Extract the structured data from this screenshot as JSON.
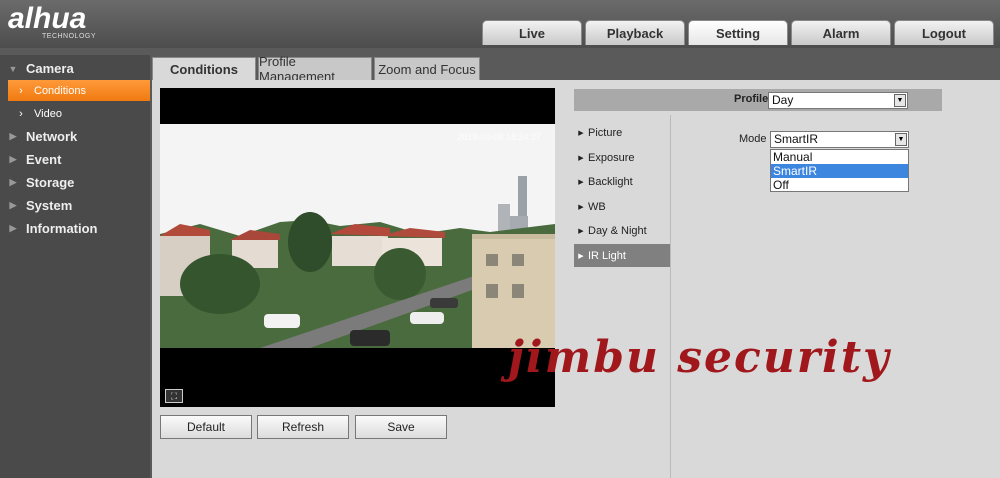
{
  "logo": {
    "text": "alhua",
    "subtitle": "TECHNOLOGY"
  },
  "nav": {
    "tabs": [
      "Live",
      "Playback",
      "Setting",
      "Alarm",
      "Logout"
    ],
    "active": "Setting"
  },
  "sidebar": {
    "items": [
      {
        "label": "Camera",
        "expanded": true
      },
      {
        "label": "Conditions",
        "sub": true,
        "active": true
      },
      {
        "label": "Video",
        "sub": true
      },
      {
        "label": "Network"
      },
      {
        "label": "Event"
      },
      {
        "label": "Storage"
      },
      {
        "label": "System"
      },
      {
        "label": "Information"
      }
    ]
  },
  "content_tabs": [
    "Conditions",
    "Profile Management",
    "Zoom and Focus"
  ],
  "video": {
    "timestamp": "2018-09-08 18:34:27",
    "fullscreen_icon": "fullscreen-icon"
  },
  "buttons": {
    "default": "Default",
    "refresh": "Refresh",
    "save": "Save"
  },
  "profile": {
    "label": "Profile",
    "value": "Day"
  },
  "menu": [
    "Picture",
    "Exposure",
    "Backlight",
    "WB",
    "Day & Night",
    "IR Light"
  ],
  "menu_active": "IR Light",
  "mode": {
    "label": "Mode",
    "value": "SmartIR",
    "options": [
      "Manual",
      "SmartIR",
      "Off"
    ],
    "selected": "SmartIR"
  },
  "watermark": "jimbu security",
  "colors": {
    "accent": "#f58a1f",
    "selection": "#3d86e0",
    "watermark": "#a0171c"
  }
}
